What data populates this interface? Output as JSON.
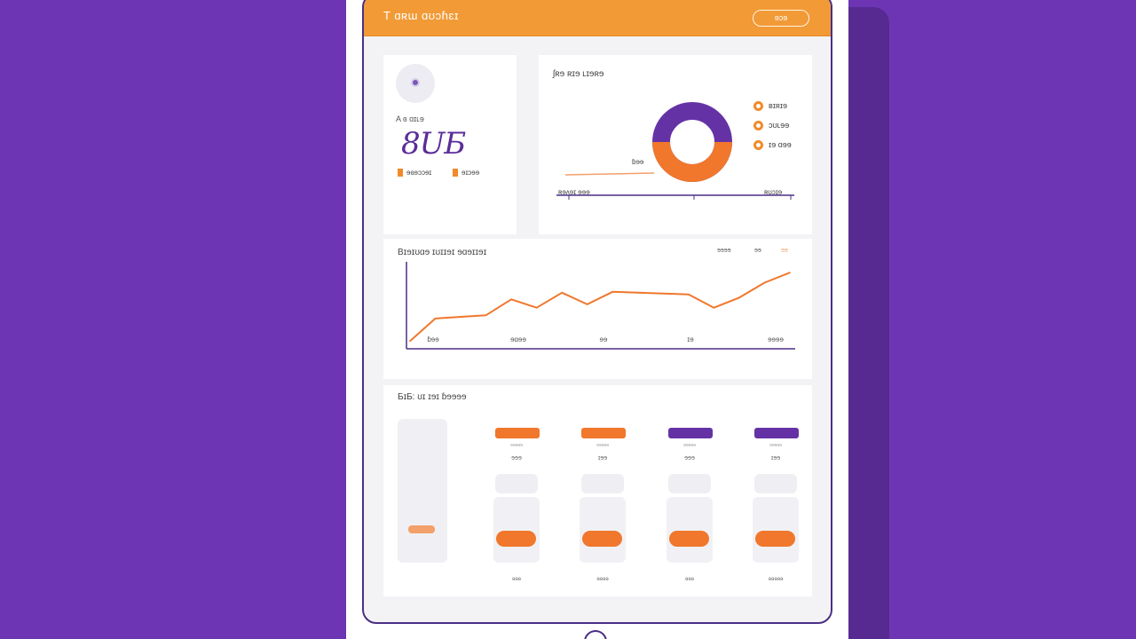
{
  "header": {
    "title": "T ɑʀɯ ɑʊɔɦɛɪ",
    "button_label": "ɘɔɘ"
  },
  "profile": {
    "label": "A ɞ ɑɪʟɘ",
    "big_value": "8UƂ",
    "sub_a": "ɘɞɘɔɔɘɪ",
    "sub_b": "ɘɪɔɘɘ"
  },
  "donut": {
    "title": "ʃʀɘ ʀɪɘ ʟɪɘʀɘ",
    "legend": [
      "ʙɪʀɪɘ",
      "ɔʊʟɘɘ",
      "ɪɘ ɑɘɘ"
    ],
    "slice_label": "ɓɘɘ",
    "foot_left": "ʀɘʌɘɪ ɘɘɘ",
    "foot_right": "ʀʊɔɪɘ"
  },
  "line_chart": {
    "title": "Bɪɘɪʊɑɘ ɪʊɪɪɘɪ ɘɑɘɪɪɘɪ",
    "legend": [
      "ɘɘɘɘ",
      "ɘɘ",
      "ɘɘ"
    ],
    "x_labels": [
      "ɓɘɘ",
      "ɘɑɘɘ",
      "ɘɘ",
      "ɪɘ",
      "ɘɘɘɘ"
    ]
  },
  "bars": {
    "title": "ƂɪƂ: ʊɪ ɪɘɪ ɓɘɘɘɘ",
    "columns": [
      {
        "tag_color": "#f0772c",
        "tiny": "ɘɘɘɘɘ",
        "label": "ɘɘɘ",
        "foot": "ɘɘɘ"
      },
      {
        "tag_color": "#f0772c",
        "tiny": "ɘɘɘɘɘ",
        "label": "ɪɘɘ",
        "foot": "ɘɘɘɘ"
      },
      {
        "tag_color": "#6532a6",
        "tiny": "ɘɘɘɘɘ",
        "label": "ɘɘɘ",
        "foot": "ɘɘɘ"
      },
      {
        "tag_color": "#6532a6",
        "tiny": "ɘɘɘɘɘ",
        "label": "ɪɘɘ",
        "foot": "ɘɘɘɘɘ"
      }
    ]
  },
  "colors": {
    "background": "#6d35b3",
    "accent_orange": "#f29a36",
    "accent_purple": "#5b2d99"
  },
  "chart_data": {
    "type": "line",
    "x": [
      0,
      1,
      2,
      3,
      4,
      5,
      6,
      7,
      8,
      9,
      10,
      11,
      12,
      13,
      14,
      15
    ],
    "values": [
      5,
      32,
      34,
      36,
      55,
      45,
      63,
      49,
      64,
      63,
      62,
      61,
      45,
      57,
      75,
      87
    ],
    "xlabel": "",
    "ylabel": "",
    "ylim": [
      0,
      100
    ]
  }
}
